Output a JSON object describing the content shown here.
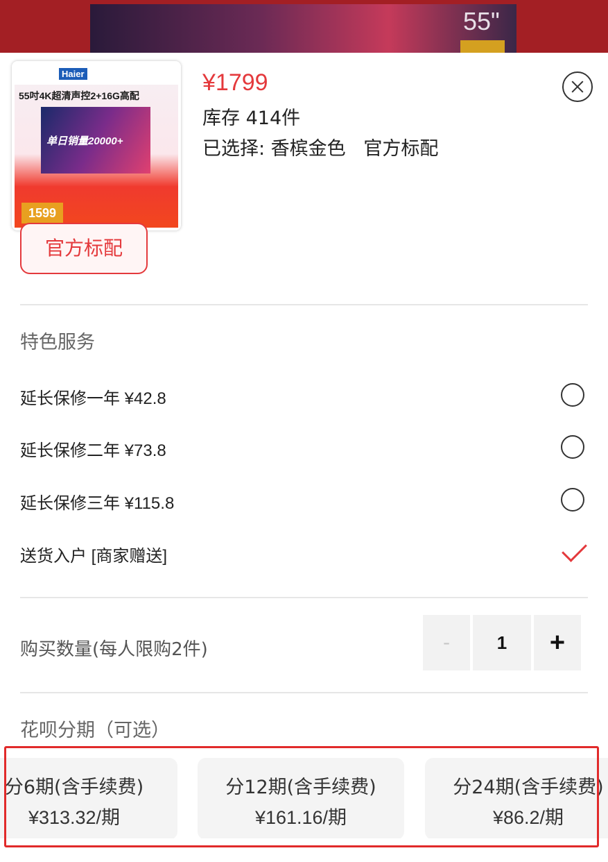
{
  "background": {
    "tv_size": "55\""
  },
  "product": {
    "thumbnail": {
      "logo": "Haier",
      "title": "55吋4K超清声控2+16G高配",
      "banner": "单日销量20000+",
      "price_tag": "1599"
    },
    "price": "¥1799",
    "stock": "库存 414件",
    "selected": "已选择: 香槟金色   官方标配"
  },
  "spec": {
    "option_label": "官方标配"
  },
  "services": {
    "title": "特色服务",
    "items": [
      {
        "label": "延长保修一年 ¥42.8",
        "selected": false
      },
      {
        "label": "延长保修二年 ¥73.8",
        "selected": false
      },
      {
        "label": "延长保修三年 ¥115.8",
        "selected": false
      },
      {
        "label": "送货入户 [商家赠送]",
        "selected": true
      }
    ]
  },
  "quantity": {
    "label": "购买数量(每人限购2件)",
    "minus": "-",
    "value": "1",
    "plus": "+"
  },
  "installments": {
    "title": "花呗分期（可选）",
    "options": [
      {
        "period": "分6期(含手续费)",
        "amount": "¥313.32/期"
      },
      {
        "period": "分12期(含手续费)",
        "amount": "¥161.16/期"
      },
      {
        "period": "分24期(含手续费)",
        "amount": "¥86.2/期"
      }
    ]
  },
  "colors": {
    "accent": "#e4393c",
    "highlight_box": "#e12a2a"
  }
}
